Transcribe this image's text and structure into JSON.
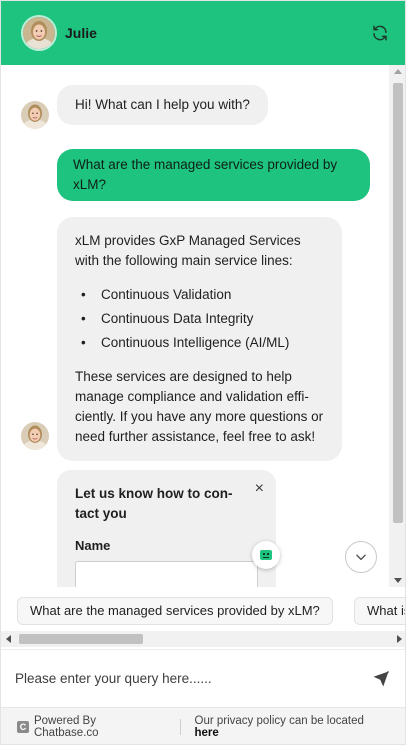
{
  "header": {
    "agent_name": "Julie",
    "refresh_icon": "refresh-icon",
    "accent_color": "#1ec37f"
  },
  "messages": [
    {
      "role": "assistant",
      "text": "Hi! What can I help you with?"
    },
    {
      "role": "user",
      "text": "What are the managed services provided by xLM?"
    },
    {
      "role": "assistant",
      "intro": "xLM provides GxP Managed Services with the following main service lines:",
      "items": [
        "Continuous Validation",
        "Continuous Data Integrity",
        "Continuous Intelligence (AI/ML)"
      ],
      "outro": "These services are designed to help manage compliance and validation effi-ciently. If you have any more questions or need further assistance, feel free to ask!"
    }
  ],
  "contact_form": {
    "title": "Let us know how to con-tact you",
    "close_label": "×",
    "name_label": "Name",
    "name_value": ""
  },
  "suggestions": [
    "What are the managed services provided by xLM?",
    "What is"
  ],
  "composer": {
    "placeholder": "Please enter your query here......",
    "send_icon": "send-icon"
  },
  "footer": {
    "logo_letter": "C",
    "powered_by": "Powered By Chatbase.co",
    "privacy_text": "Our privacy policy can be located",
    "privacy_link": "here"
  }
}
